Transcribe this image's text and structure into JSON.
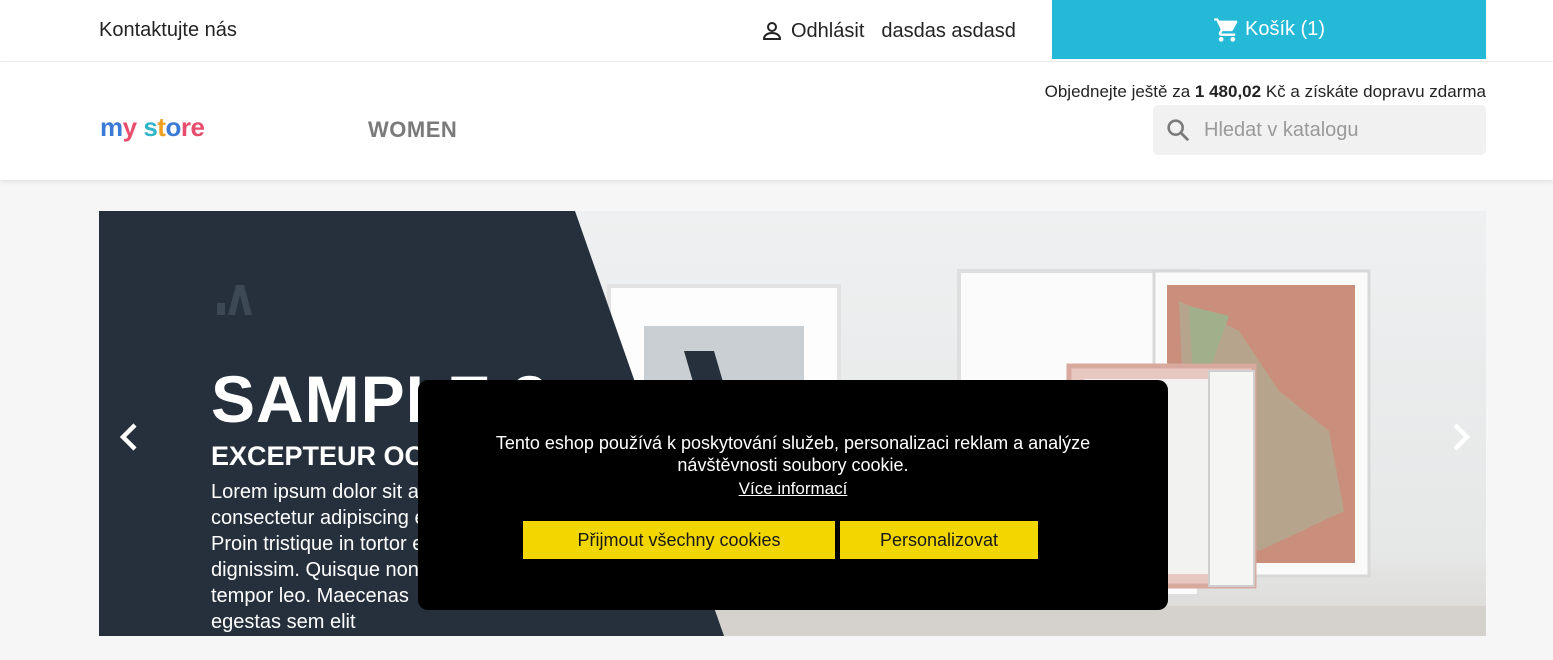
{
  "topbar": {
    "contact": "Kontaktujte nás",
    "logout": "Odhlásit",
    "user_name": "dasdas asdasd",
    "cart_label": "Košík (1)"
  },
  "header": {
    "logo": "my store",
    "nav_women": "WOMEN",
    "shipping_prefix": "Objednejte ještě za",
    "shipping_amount": "1 480,02",
    "shipping_suffix": "Kč a získáte dopravu zdarma",
    "search_placeholder": "Hledat v katalogu"
  },
  "slider": {
    "title": "SAMPLE 3",
    "subtitle": "EXCEPTEUR OCCAECAT",
    "description": "Lorem ipsum dolor sit amet, consectetur adipiscing elit. Proin tristique in tortor et dignissim. Quisque non tempor leo. Maecenas egestas sem elit"
  },
  "cookie": {
    "message": "Tento eshop používá k poskytování služeb, personalizaci reklam a analýze návštěvnosti soubory cookie.",
    "more_link": "Více informací",
    "accept_button": "Přijmout všechny cookies",
    "personalize_button": "Personalizovat"
  },
  "colors": {
    "cart_bg": "#24b9d7",
    "cookie_button": "#f2d600",
    "slide_dark": "#25303c"
  },
  "icons": [
    "user-icon",
    "cart-icon",
    "search-icon",
    "chevron-left-icon",
    "chevron-right-icon"
  ]
}
